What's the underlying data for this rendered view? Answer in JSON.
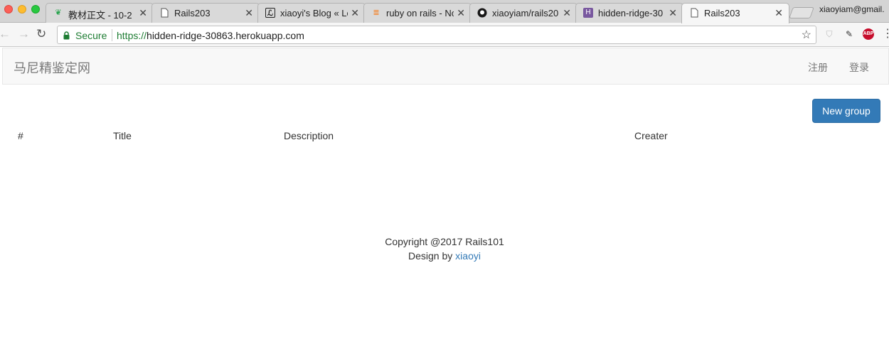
{
  "browser": {
    "tabs": [
      {
        "title": "教材正文 - 10-2",
        "icon": "leaf-icon"
      },
      {
        "title": "Rails203",
        "icon": "page-icon"
      },
      {
        "title": "xiaoyi's Blog « Lo",
        "icon": "blog-icon"
      },
      {
        "title": "ruby on rails - No",
        "icon": "stackoverflow-icon"
      },
      {
        "title": "xiaoyiam/rails20",
        "icon": "github-icon"
      },
      {
        "title": "hidden-ridge-30",
        "icon": "heroku-icon"
      },
      {
        "title": "Rails203",
        "icon": "page-icon"
      }
    ],
    "profile": "xiaoyiam@gmail.",
    "secure_label": "Secure",
    "url_scheme": "https://",
    "url_host": "hidden-ridge-30863.herokuapp.com",
    "extensions": {
      "abp": "ABP"
    }
  },
  "navbar": {
    "brand": "马尼精鉴定网",
    "register": "注册",
    "login": "登录"
  },
  "page": {
    "new_group_label": "New group"
  },
  "table": {
    "headers": [
      "#",
      "Title",
      "Description",
      "Creater"
    ]
  },
  "footer": {
    "copyright": "Copyright @2017 Rails101",
    "design_prefix": "Design by ",
    "design_link": "xiaoyi"
  }
}
